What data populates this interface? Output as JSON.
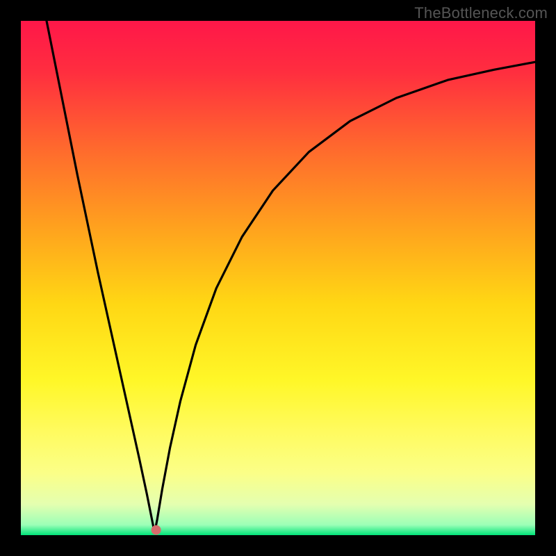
{
  "attribution": "TheBottleneck.com",
  "chart_data": {
    "type": "line",
    "title": "",
    "xlabel": "",
    "ylabel": "",
    "xlim": [
      0,
      1
    ],
    "ylim": [
      0,
      1
    ],
    "gradient_stops": [
      {
        "offset": 0.0,
        "color": "#ff1749"
      },
      {
        "offset": 0.1,
        "color": "#ff2e3f"
      },
      {
        "offset": 0.25,
        "color": "#ff6a2d"
      },
      {
        "offset": 0.4,
        "color": "#ffa11e"
      },
      {
        "offset": 0.55,
        "color": "#ffd714"
      },
      {
        "offset": 0.7,
        "color": "#fff728"
      },
      {
        "offset": 0.8,
        "color": "#fffb60"
      },
      {
        "offset": 0.88,
        "color": "#fbff88"
      },
      {
        "offset": 0.94,
        "color": "#e4ffb0"
      },
      {
        "offset": 0.98,
        "color": "#9cffb7"
      },
      {
        "offset": 1.0,
        "color": "#00e37a"
      }
    ],
    "main_curve": {
      "apex_x": 0.26,
      "points": [
        {
          "x": 0.05,
          "y": 1.0
        },
        {
          "x": 0.07,
          "y": 0.9
        },
        {
          "x": 0.09,
          "y": 0.8
        },
        {
          "x": 0.11,
          "y": 0.7
        },
        {
          "x": 0.13,
          "y": 0.605
        },
        {
          "x": 0.15,
          "y": 0.51
        },
        {
          "x": 0.17,
          "y": 0.42
        },
        {
          "x": 0.19,
          "y": 0.33
        },
        {
          "x": 0.21,
          "y": 0.24
        },
        {
          "x": 0.23,
          "y": 0.15
        },
        {
          "x": 0.245,
          "y": 0.08
        },
        {
          "x": 0.255,
          "y": 0.03
        },
        {
          "x": 0.26,
          "y": 0.005
        },
        {
          "x": 0.265,
          "y": 0.03
        },
        {
          "x": 0.275,
          "y": 0.09
        },
        {
          "x": 0.29,
          "y": 0.17
        },
        {
          "x": 0.31,
          "y": 0.26
        },
        {
          "x": 0.34,
          "y": 0.37
        },
        {
          "x": 0.38,
          "y": 0.48
        },
        {
          "x": 0.43,
          "y": 0.58
        },
        {
          "x": 0.49,
          "y": 0.67
        },
        {
          "x": 0.56,
          "y": 0.745
        },
        {
          "x": 0.64,
          "y": 0.805
        },
        {
          "x": 0.73,
          "y": 0.85
        },
        {
          "x": 0.83,
          "y": 0.885
        },
        {
          "x": 0.92,
          "y": 0.905
        },
        {
          "x": 1.0,
          "y": 0.92
        }
      ]
    },
    "marker": {
      "x": 0.263,
      "y": 0.01,
      "color": "#d66b6b",
      "radius": 7
    }
  }
}
